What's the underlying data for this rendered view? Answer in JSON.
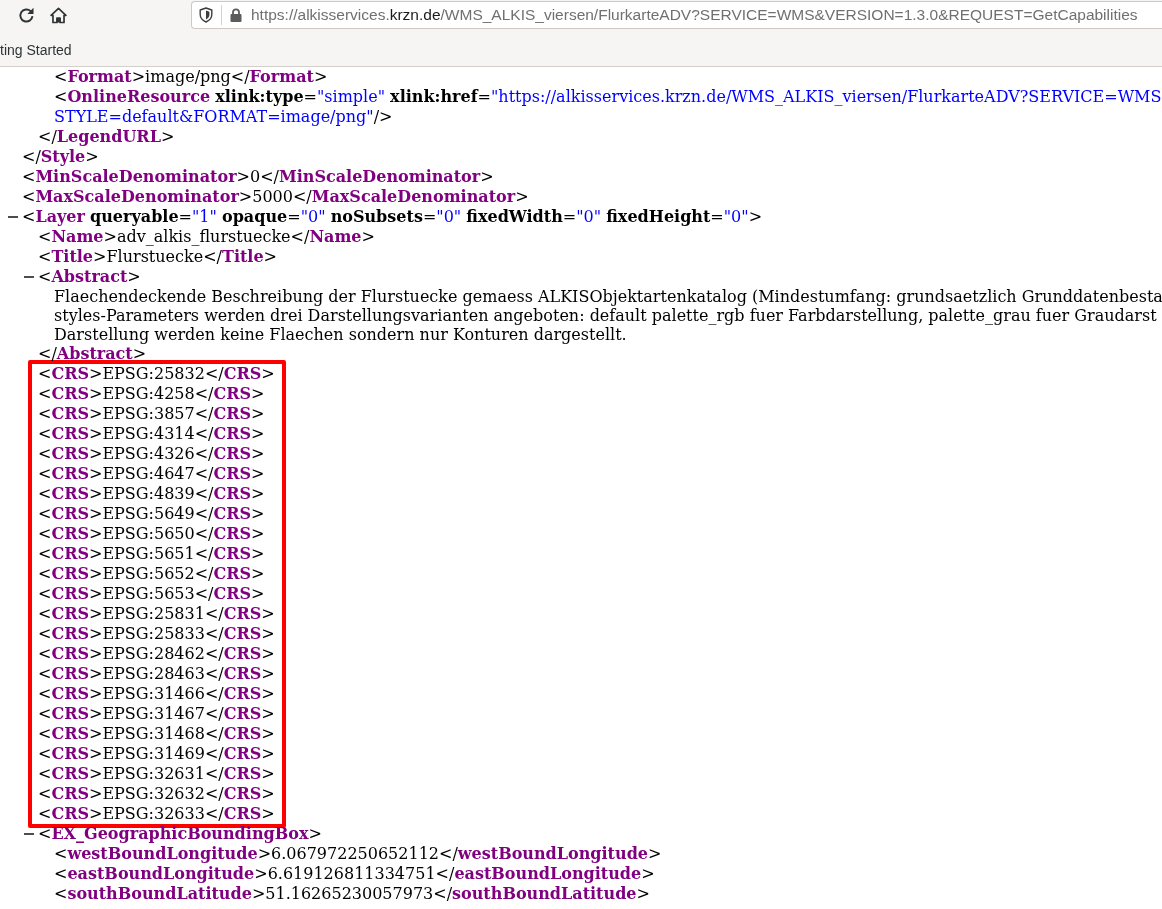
{
  "browser": {
    "address_bar": {
      "before_domain": "https://alkisservices.",
      "domain": "krzn.de",
      "after_domain": "/WMS_ALKIS_viersen/FlurkarteADV?SERVICE=WMS&VERSION=1.3.0&REQUEST=GetCapabilities"
    },
    "bookmarks": [
      {
        "label": "ting Started"
      }
    ]
  },
  "xml": {
    "nodes": [
      {
        "kind": "open_above",
        "children": [
          {
            "kind": "open_above",
            "children": [
              {
                "kind": "element",
                "lines": [
                  [
                    {
                      "kind": "markup",
                      "text": "<"
                    },
                    {
                      "kind": "tag",
                      "text": "Format"
                    },
                    {
                      "kind": "markup",
                      "text": ">"
                    },
                    {
                      "kind": "content",
                      "text": "image/png"
                    },
                    {
                      "kind": "markup",
                      "text": "</"
                    },
                    {
                      "kind": "tag",
                      "text": "Format"
                    },
                    {
                      "kind": "markup",
                      "text": ">"
                    }
                  ]
                ]
              },
              {
                "kind": "element",
                "lines": [
                  [
                    {
                      "kind": "markup",
                      "text": "<"
                    },
                    {
                      "kind": "tag",
                      "text": "OnlineResource"
                    },
                    {
                      "kind": "attr",
                      "text": "xlink:type"
                    },
                    {
                      "kind": "markup",
                      "text": "="
                    },
                    {
                      "kind": "value",
                      "text": "\"simple\""
                    },
                    {
                      "kind": "attr",
                      "text": "xlink:href"
                    },
                    {
                      "kind": "markup",
                      "text": "="
                    },
                    {
                      "kind": "value",
                      "text": "\"https://alkisservices.krzn.de/WMS_ALKIS_viersen/FlurkarteADV?SERVICE=WMS"
                    }
                  ],
                  [
                    {
                      "kind": "value",
                      "text": "STYLE=default&FORMAT=image/png\""
                    },
                    {
                      "kind": "markup",
                      "text": "/>"
                    }
                  ]
                ]
              }
            ],
            "close": [
              {
                "kind": "markup",
                "text": "</"
              },
              {
                "kind": "tag",
                "text": "LegendURL"
              },
              {
                "kind": "markup",
                "text": ">"
              }
            ]
          }
        ],
        "close": [
          {
            "kind": "markup",
            "text": "</"
          },
          {
            "kind": "tag",
            "text": "Style"
          },
          {
            "kind": "markup",
            "text": ">"
          }
        ]
      },
      {
        "kind": "element",
        "lines": [
          [
            {
              "kind": "markup",
              "text": "<"
            },
            {
              "kind": "tag",
              "text": "MinScaleDenominator"
            },
            {
              "kind": "markup",
              "text": ">"
            },
            {
              "kind": "content",
              "text": "0"
            },
            {
              "kind": "markup",
              "text": "</"
            },
            {
              "kind": "tag",
              "text": "MinScaleDenominator"
            },
            {
              "kind": "markup",
              "text": ">"
            }
          ]
        ]
      },
      {
        "kind": "element",
        "lines": [
          [
            {
              "kind": "markup",
              "text": "<"
            },
            {
              "kind": "tag",
              "text": "MaxScaleDenominator"
            },
            {
              "kind": "markup",
              "text": ">"
            },
            {
              "kind": "content",
              "text": "5000"
            },
            {
              "kind": "markup",
              "text": "</"
            },
            {
              "kind": "tag",
              "text": "MaxScaleDenominator"
            },
            {
              "kind": "markup",
              "text": ">"
            }
          ]
        ]
      },
      {
        "kind": "cut_below",
        "expanded": true,
        "open": [
          {
            "kind": "markup",
            "text": "<"
          },
          {
            "kind": "tag",
            "text": "Layer"
          },
          {
            "kind": "attr",
            "text": "queryable"
          },
          {
            "kind": "markup",
            "text": "="
          },
          {
            "kind": "value",
            "text": "\"1\""
          },
          {
            "kind": "attr",
            "text": "opaque"
          },
          {
            "kind": "markup",
            "text": "="
          },
          {
            "kind": "value",
            "text": "\"0\""
          },
          {
            "kind": "attr",
            "text": "noSubsets"
          },
          {
            "kind": "markup",
            "text": "="
          },
          {
            "kind": "value",
            "text": "\"0\""
          },
          {
            "kind": "attr",
            "text": "fixedWidth"
          },
          {
            "kind": "markup",
            "text": "="
          },
          {
            "kind": "value",
            "text": "\"0\""
          },
          {
            "kind": "attr",
            "text": "fixedHeight"
          },
          {
            "kind": "markup",
            "text": "="
          },
          {
            "kind": "value",
            "text": "\"0\""
          },
          {
            "kind": "markup",
            "text": ">"
          }
        ],
        "children": [
          {
            "kind": "element",
            "lines": [
              [
                {
                  "kind": "markup",
                  "text": "<"
                },
                {
                  "kind": "tag",
                  "text": "Name"
                },
                {
                  "kind": "markup",
                  "text": ">"
                },
                {
                  "kind": "content",
                  "text": "adv_alkis_flurstuecke"
                },
                {
                  "kind": "markup",
                  "text": "</"
                },
                {
                  "kind": "tag",
                  "text": "Name"
                },
                {
                  "kind": "markup",
                  "text": ">"
                }
              ]
            ]
          },
          {
            "kind": "element",
            "lines": [
              [
                {
                  "kind": "markup",
                  "text": "<"
                },
                {
                  "kind": "tag",
                  "text": "Title"
                },
                {
                  "kind": "markup",
                  "text": ">"
                },
                {
                  "kind": "content",
                  "text": "Flurstuecke"
                },
                {
                  "kind": "markup",
                  "text": "</"
                },
                {
                  "kind": "tag",
                  "text": "Title"
                },
                {
                  "kind": "markup",
                  "text": ">"
                }
              ]
            ]
          },
          {
            "kind": "container",
            "expanded": true,
            "open": [
              {
                "kind": "markup",
                "text": "<"
              },
              {
                "kind": "tag",
                "text": "Abstract"
              },
              {
                "kind": "markup",
                "text": ">"
              }
            ],
            "children": [
              {
                "kind": "text",
                "lines": [
                  "Flaechendeckende Beschreibung der Flurstuecke gemaess ALKISObjektartenkatalog (Mindestumfang: grundsaetzlich Grunddatenbesta",
                  "styles-Parameters werden drei Darstellungsvarianten angeboten: default palette_rgb fuer Farbdarstellung, palette_grau fuer Graudarst",
                  "Darstellung werden keine Flaechen sondern nur Konturen dargestellt."
                ]
              }
            ],
            "close": [
              {
                "kind": "markup",
                "text": "</"
              },
              {
                "kind": "tag",
                "text": "Abstract"
              },
              {
                "kind": "markup",
                "text": ">"
              }
            ]
          },
          {
            "kind": "highlight",
            "children": [
              {
                "kind": "element",
                "lines": [
                  [
                    {
                      "kind": "markup",
                      "text": "<"
                    },
                    {
                      "kind": "tag",
                      "text": "CRS"
                    },
                    {
                      "kind": "markup",
                      "text": ">"
                    },
                    {
                      "kind": "content",
                      "text": "EPSG:25832"
                    },
                    {
                      "kind": "markup",
                      "text": "</"
                    },
                    {
                      "kind": "tag",
                      "text": "CRS"
                    },
                    {
                      "kind": "markup",
                      "text": ">"
                    }
                  ]
                ]
              },
              {
                "kind": "element",
                "lines": [
                  [
                    {
                      "kind": "markup",
                      "text": "<"
                    },
                    {
                      "kind": "tag",
                      "text": "CRS"
                    },
                    {
                      "kind": "markup",
                      "text": ">"
                    },
                    {
                      "kind": "content",
                      "text": "EPSG:4258"
                    },
                    {
                      "kind": "markup",
                      "text": "</"
                    },
                    {
                      "kind": "tag",
                      "text": "CRS"
                    },
                    {
                      "kind": "markup",
                      "text": ">"
                    }
                  ]
                ]
              },
              {
                "kind": "element",
                "lines": [
                  [
                    {
                      "kind": "markup",
                      "text": "<"
                    },
                    {
                      "kind": "tag",
                      "text": "CRS"
                    },
                    {
                      "kind": "markup",
                      "text": ">"
                    },
                    {
                      "kind": "content",
                      "text": "EPSG:3857"
                    },
                    {
                      "kind": "markup",
                      "text": "</"
                    },
                    {
                      "kind": "tag",
                      "text": "CRS"
                    },
                    {
                      "kind": "markup",
                      "text": ">"
                    }
                  ]
                ]
              },
              {
                "kind": "element",
                "lines": [
                  [
                    {
                      "kind": "markup",
                      "text": "<"
                    },
                    {
                      "kind": "tag",
                      "text": "CRS"
                    },
                    {
                      "kind": "markup",
                      "text": ">"
                    },
                    {
                      "kind": "content",
                      "text": "EPSG:4314"
                    },
                    {
                      "kind": "markup",
                      "text": "</"
                    },
                    {
                      "kind": "tag",
                      "text": "CRS"
                    },
                    {
                      "kind": "markup",
                      "text": ">"
                    }
                  ]
                ]
              },
              {
                "kind": "element",
                "lines": [
                  [
                    {
                      "kind": "markup",
                      "text": "<"
                    },
                    {
                      "kind": "tag",
                      "text": "CRS"
                    },
                    {
                      "kind": "markup",
                      "text": ">"
                    },
                    {
                      "kind": "content",
                      "text": "EPSG:4326"
                    },
                    {
                      "kind": "markup",
                      "text": "</"
                    },
                    {
                      "kind": "tag",
                      "text": "CRS"
                    },
                    {
                      "kind": "markup",
                      "text": ">"
                    }
                  ]
                ]
              },
              {
                "kind": "element",
                "lines": [
                  [
                    {
                      "kind": "markup",
                      "text": "<"
                    },
                    {
                      "kind": "tag",
                      "text": "CRS"
                    },
                    {
                      "kind": "markup",
                      "text": ">"
                    },
                    {
                      "kind": "content",
                      "text": "EPSG:4647"
                    },
                    {
                      "kind": "markup",
                      "text": "</"
                    },
                    {
                      "kind": "tag",
                      "text": "CRS"
                    },
                    {
                      "kind": "markup",
                      "text": ">"
                    }
                  ]
                ]
              },
              {
                "kind": "element",
                "lines": [
                  [
                    {
                      "kind": "markup",
                      "text": "<"
                    },
                    {
                      "kind": "tag",
                      "text": "CRS"
                    },
                    {
                      "kind": "markup",
                      "text": ">"
                    },
                    {
                      "kind": "content",
                      "text": "EPSG:4839"
                    },
                    {
                      "kind": "markup",
                      "text": "</"
                    },
                    {
                      "kind": "tag",
                      "text": "CRS"
                    },
                    {
                      "kind": "markup",
                      "text": ">"
                    }
                  ]
                ]
              },
              {
                "kind": "element",
                "lines": [
                  [
                    {
                      "kind": "markup",
                      "text": "<"
                    },
                    {
                      "kind": "tag",
                      "text": "CRS"
                    },
                    {
                      "kind": "markup",
                      "text": ">"
                    },
                    {
                      "kind": "content",
                      "text": "EPSG:5649"
                    },
                    {
                      "kind": "markup",
                      "text": "</"
                    },
                    {
                      "kind": "tag",
                      "text": "CRS"
                    },
                    {
                      "kind": "markup",
                      "text": ">"
                    }
                  ]
                ]
              },
              {
                "kind": "element",
                "lines": [
                  [
                    {
                      "kind": "markup",
                      "text": "<"
                    },
                    {
                      "kind": "tag",
                      "text": "CRS"
                    },
                    {
                      "kind": "markup",
                      "text": ">"
                    },
                    {
                      "kind": "content",
                      "text": "EPSG:5650"
                    },
                    {
                      "kind": "markup",
                      "text": "</"
                    },
                    {
                      "kind": "tag",
                      "text": "CRS"
                    },
                    {
                      "kind": "markup",
                      "text": ">"
                    }
                  ]
                ]
              },
              {
                "kind": "element",
                "lines": [
                  [
                    {
                      "kind": "markup",
                      "text": "<"
                    },
                    {
                      "kind": "tag",
                      "text": "CRS"
                    },
                    {
                      "kind": "markup",
                      "text": ">"
                    },
                    {
                      "kind": "content",
                      "text": "EPSG:5651"
                    },
                    {
                      "kind": "markup",
                      "text": "</"
                    },
                    {
                      "kind": "tag",
                      "text": "CRS"
                    },
                    {
                      "kind": "markup",
                      "text": ">"
                    }
                  ]
                ]
              },
              {
                "kind": "element",
                "lines": [
                  [
                    {
                      "kind": "markup",
                      "text": "<"
                    },
                    {
                      "kind": "tag",
                      "text": "CRS"
                    },
                    {
                      "kind": "markup",
                      "text": ">"
                    },
                    {
                      "kind": "content",
                      "text": "EPSG:5652"
                    },
                    {
                      "kind": "markup",
                      "text": "</"
                    },
                    {
                      "kind": "tag",
                      "text": "CRS"
                    },
                    {
                      "kind": "markup",
                      "text": ">"
                    }
                  ]
                ]
              },
              {
                "kind": "element",
                "lines": [
                  [
                    {
                      "kind": "markup",
                      "text": "<"
                    },
                    {
                      "kind": "tag",
                      "text": "CRS"
                    },
                    {
                      "kind": "markup",
                      "text": ">"
                    },
                    {
                      "kind": "content",
                      "text": "EPSG:5653"
                    },
                    {
                      "kind": "markup",
                      "text": "</"
                    },
                    {
                      "kind": "tag",
                      "text": "CRS"
                    },
                    {
                      "kind": "markup",
                      "text": ">"
                    }
                  ]
                ]
              },
              {
                "kind": "element",
                "lines": [
                  [
                    {
                      "kind": "markup",
                      "text": "<"
                    },
                    {
                      "kind": "tag",
                      "text": "CRS"
                    },
                    {
                      "kind": "markup",
                      "text": ">"
                    },
                    {
                      "kind": "content",
                      "text": "EPSG:25831"
                    },
                    {
                      "kind": "markup",
                      "text": "</"
                    },
                    {
                      "kind": "tag",
                      "text": "CRS"
                    },
                    {
                      "kind": "markup",
                      "text": ">"
                    }
                  ]
                ]
              },
              {
                "kind": "element",
                "lines": [
                  [
                    {
                      "kind": "markup",
                      "text": "<"
                    },
                    {
                      "kind": "tag",
                      "text": "CRS"
                    },
                    {
                      "kind": "markup",
                      "text": ">"
                    },
                    {
                      "kind": "content",
                      "text": "EPSG:25833"
                    },
                    {
                      "kind": "markup",
                      "text": "</"
                    },
                    {
                      "kind": "tag",
                      "text": "CRS"
                    },
                    {
                      "kind": "markup",
                      "text": ">"
                    }
                  ]
                ]
              },
              {
                "kind": "element",
                "lines": [
                  [
                    {
                      "kind": "markup",
                      "text": "<"
                    },
                    {
                      "kind": "tag",
                      "text": "CRS"
                    },
                    {
                      "kind": "markup",
                      "text": ">"
                    },
                    {
                      "kind": "content",
                      "text": "EPSG:28462"
                    },
                    {
                      "kind": "markup",
                      "text": "</"
                    },
                    {
                      "kind": "tag",
                      "text": "CRS"
                    },
                    {
                      "kind": "markup",
                      "text": ">"
                    }
                  ]
                ]
              },
              {
                "kind": "element",
                "lines": [
                  [
                    {
                      "kind": "markup",
                      "text": "<"
                    },
                    {
                      "kind": "tag",
                      "text": "CRS"
                    },
                    {
                      "kind": "markup",
                      "text": ">"
                    },
                    {
                      "kind": "content",
                      "text": "EPSG:28463"
                    },
                    {
                      "kind": "markup",
                      "text": "</"
                    },
                    {
                      "kind": "tag",
                      "text": "CRS"
                    },
                    {
                      "kind": "markup",
                      "text": ">"
                    }
                  ]
                ]
              },
              {
                "kind": "element",
                "lines": [
                  [
                    {
                      "kind": "markup",
                      "text": "<"
                    },
                    {
                      "kind": "tag",
                      "text": "CRS"
                    },
                    {
                      "kind": "markup",
                      "text": ">"
                    },
                    {
                      "kind": "content",
                      "text": "EPSG:31466"
                    },
                    {
                      "kind": "markup",
                      "text": "</"
                    },
                    {
                      "kind": "tag",
                      "text": "CRS"
                    },
                    {
                      "kind": "markup",
                      "text": ">"
                    }
                  ]
                ]
              },
              {
                "kind": "element",
                "lines": [
                  [
                    {
                      "kind": "markup",
                      "text": "<"
                    },
                    {
                      "kind": "tag",
                      "text": "CRS"
                    },
                    {
                      "kind": "markup",
                      "text": ">"
                    },
                    {
                      "kind": "content",
                      "text": "EPSG:31467"
                    },
                    {
                      "kind": "markup",
                      "text": "</"
                    },
                    {
                      "kind": "tag",
                      "text": "CRS"
                    },
                    {
                      "kind": "markup",
                      "text": ">"
                    }
                  ]
                ]
              },
              {
                "kind": "element",
                "lines": [
                  [
                    {
                      "kind": "markup",
                      "text": "<"
                    },
                    {
                      "kind": "tag",
                      "text": "CRS"
                    },
                    {
                      "kind": "markup",
                      "text": ">"
                    },
                    {
                      "kind": "content",
                      "text": "EPSG:31468"
                    },
                    {
                      "kind": "markup",
                      "text": "</"
                    },
                    {
                      "kind": "tag",
                      "text": "CRS"
                    },
                    {
                      "kind": "markup",
                      "text": ">"
                    }
                  ]
                ]
              },
              {
                "kind": "element",
                "lines": [
                  [
                    {
                      "kind": "markup",
                      "text": "<"
                    },
                    {
                      "kind": "tag",
                      "text": "CRS"
                    },
                    {
                      "kind": "markup",
                      "text": ">"
                    },
                    {
                      "kind": "content",
                      "text": "EPSG:31469"
                    },
                    {
                      "kind": "markup",
                      "text": "</"
                    },
                    {
                      "kind": "tag",
                      "text": "CRS"
                    },
                    {
                      "kind": "markup",
                      "text": ">"
                    }
                  ]
                ]
              },
              {
                "kind": "element",
                "lines": [
                  [
                    {
                      "kind": "markup",
                      "text": "<"
                    },
                    {
                      "kind": "tag",
                      "text": "CRS"
                    },
                    {
                      "kind": "markup",
                      "text": ">"
                    },
                    {
                      "kind": "content",
                      "text": "EPSG:32631"
                    },
                    {
                      "kind": "markup",
                      "text": "</"
                    },
                    {
                      "kind": "tag",
                      "text": "CRS"
                    },
                    {
                      "kind": "markup",
                      "text": ">"
                    }
                  ]
                ]
              },
              {
                "kind": "element",
                "lines": [
                  [
                    {
                      "kind": "markup",
                      "text": "<"
                    },
                    {
                      "kind": "tag",
                      "text": "CRS"
                    },
                    {
                      "kind": "markup",
                      "text": ">"
                    },
                    {
                      "kind": "content",
                      "text": "EPSG:32632"
                    },
                    {
                      "kind": "markup",
                      "text": "</"
                    },
                    {
                      "kind": "tag",
                      "text": "CRS"
                    },
                    {
                      "kind": "markup",
                      "text": ">"
                    }
                  ]
                ]
              },
              {
                "kind": "element",
                "lines": [
                  [
                    {
                      "kind": "markup",
                      "text": "<"
                    },
                    {
                      "kind": "tag",
                      "text": "CRS"
                    },
                    {
                      "kind": "markup",
                      "text": ">"
                    },
                    {
                      "kind": "content",
                      "text": "EPSG:32633"
                    },
                    {
                      "kind": "markup",
                      "text": "</"
                    },
                    {
                      "kind": "tag",
                      "text": "CRS"
                    },
                    {
                      "kind": "markup",
                      "text": ">"
                    }
                  ]
                ]
              }
            ]
          },
          {
            "kind": "cut_below",
            "expanded": true,
            "open": [
              {
                "kind": "markup",
                "text": "<"
              },
              {
                "kind": "tag",
                "text": "EX_GeographicBoundingBox"
              },
              {
                "kind": "markup",
                "text": ">"
              }
            ],
            "children": [
              {
                "kind": "element",
                "lines": [
                  [
                    {
                      "kind": "markup",
                      "text": "<"
                    },
                    {
                      "kind": "tag",
                      "text": "westBoundLongitude"
                    },
                    {
                      "kind": "markup",
                      "text": ">"
                    },
                    {
                      "kind": "content",
                      "text": "6.067972250652112"
                    },
                    {
                      "kind": "markup",
                      "text": "</"
                    },
                    {
                      "kind": "tag",
                      "text": "westBoundLongitude"
                    },
                    {
                      "kind": "markup",
                      "text": ">"
                    }
                  ]
                ]
              },
              {
                "kind": "element",
                "lines": [
                  [
                    {
                      "kind": "markup",
                      "text": "<"
                    },
                    {
                      "kind": "tag",
                      "text": "eastBoundLongitude"
                    },
                    {
                      "kind": "markup",
                      "text": ">"
                    },
                    {
                      "kind": "content",
                      "text": "6.619126811334751"
                    },
                    {
                      "kind": "markup",
                      "text": "</"
                    },
                    {
                      "kind": "tag",
                      "text": "eastBoundLongitude"
                    },
                    {
                      "kind": "markup",
                      "text": ">"
                    }
                  ]
                ]
              },
              {
                "kind": "element",
                "lines": [
                  [
                    {
                      "kind": "markup",
                      "text": "<"
                    },
                    {
                      "kind": "tag",
                      "text": "southBoundLatitude"
                    },
                    {
                      "kind": "markup",
                      "text": ">"
                    },
                    {
                      "kind": "content",
                      "text": "51.16265230057973"
                    },
                    {
                      "kind": "markup",
                      "text": "</"
                    },
                    {
                      "kind": "tag",
                      "text": "southBoundLatitude"
                    },
                    {
                      "kind": "markup",
                      "text": ">"
                    }
                  ]
                ]
              }
            ]
          }
        ]
      }
    ]
  }
}
